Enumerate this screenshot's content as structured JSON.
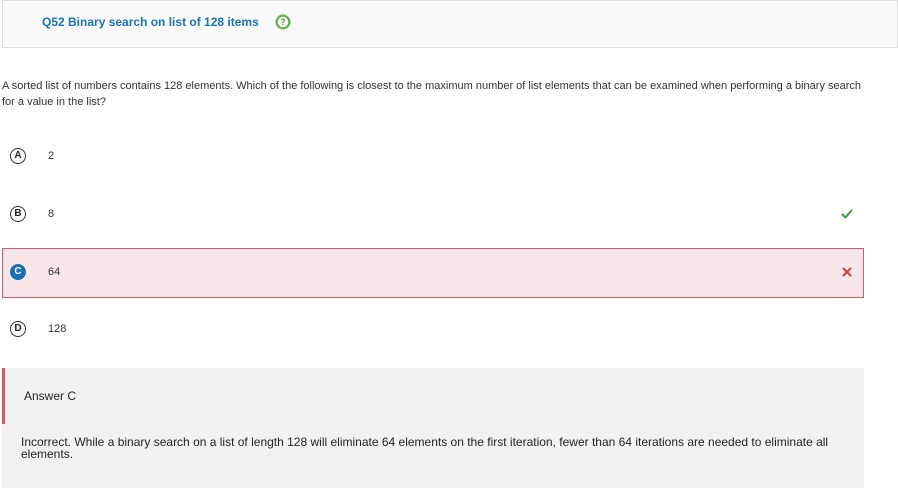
{
  "header": {
    "title": "Q52 Binary search on list of 128 items",
    "help_icon": "question-mark-icon",
    "help_color": "#6ab04c"
  },
  "question": {
    "text": "A sorted list of numbers contains 128 elements. Which of the following is closest to the maximum number of list elements that can be examined when performing a binary search for a value in the list?"
  },
  "choices": [
    {
      "letter": "A",
      "value": "2",
      "state": "none"
    },
    {
      "letter": "B",
      "value": "8",
      "state": "correct",
      "icon": "check-icon",
      "color": "#3a9a3a"
    },
    {
      "letter": "C",
      "value": "64",
      "state": "selected-incorrect",
      "icon": "close-icon",
      "color": "#d33a4f"
    },
    {
      "letter": "D",
      "value": "128",
      "state": "none"
    }
  ],
  "answer": {
    "label": "Answer C",
    "accent_color": "#d9596b"
  },
  "explanation": {
    "text": "Incorrect. While a binary search on a list of length 128 will eliminate 64 elements on the first iteration, fewer than 64 iterations are needed to eliminate all elements."
  }
}
